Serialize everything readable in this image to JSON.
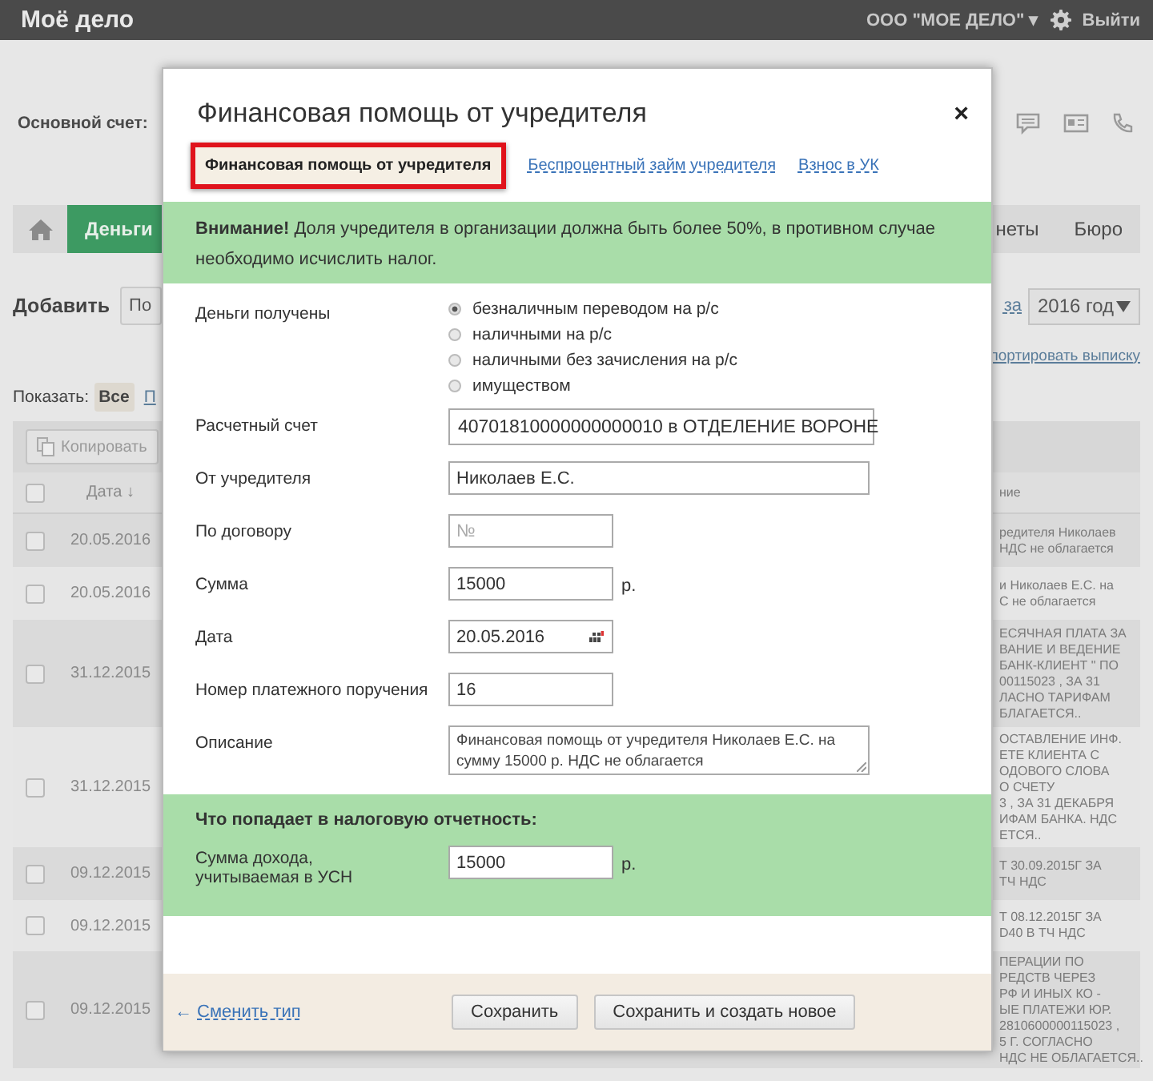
{
  "top_bar": {
    "logo": "Моё дело",
    "company": "ООО \"МОЕ ДЕЛО\"",
    "company_caret": "▾",
    "logout": "Выйти"
  },
  "account_label": "Основной счет:",
  "nav": [
    {
      "label": "Деньги",
      "selected": true
    },
    {
      "label": "неты",
      "selected": false
    },
    {
      "label": "Бюро",
      "selected": false
    }
  ],
  "toolbar": {
    "add_label": "Добавить",
    "add_button": "По",
    "period_link": "за",
    "year_select": "2016 год",
    "export_link": "портировать выписку"
  },
  "filter": {
    "label": "Показать:",
    "options": [
      {
        "label": "Все",
        "selected": true
      },
      {
        "label": "П",
        "selected": false
      }
    ]
  },
  "copy_button": "Копировать",
  "table": {
    "header_checked": false,
    "columns": [
      "Дата ↓",
      "ние"
    ],
    "rows": [
      {
        "checked": false,
        "date": "20.05.2016",
        "description": "редителя Николаев\nНДС не облагается"
      },
      {
        "checked": false,
        "date": "20.05.2016",
        "description": "и Николаев Е.С. на\nС не облагается"
      },
      {
        "checked": false,
        "date": "31.12.2015",
        "description": "ЕСЯЧНАЯ ПЛАТА ЗА\nВАНИЕ И ВЕДЕНИЕ\nБАНК-КЛИЕНТ \" ПО\n00115023 , ЗА 31\nЛАСНО ТАРИФАМ\nБЛАГАЕТСЯ.."
      },
      {
        "checked": false,
        "date": "31.12.2015",
        "description": "ОСТАВЛЕНИЕ ИНФ.\nЕТЕ КЛИЕНТА С\nОДОВОГО СЛОВА\nО СЧЕТУ\n3 , ЗА 31 ДЕКАБРЯ\nИФАМ БАНКА. НДС\nЕТСЯ.."
      },
      {
        "checked": false,
        "date": "09.12.2015",
        "description": "Т 30.09.2015Г ЗА\nТЧ НДС"
      },
      {
        "checked": false,
        "date": "09.12.2015",
        "description": "Т 08.12.2015Г ЗА\nD40 В ТЧ НДС"
      },
      {
        "checked": false,
        "date": "09.12.2015",
        "description": "ПЕРАЦИИ ПО\nРЕДСТВ ЧЕРЕЗ\nРФ И ИНЫХ КО -\nЫЕ ПЛАТЕЖИ ЮР.\n2810600000115023 ,\n5 Г. СОГЛАСНО\nНДС НЕ ОБЛАГАЕТСЯ.."
      }
    ]
  },
  "modal": {
    "title": "Финансовая помощь от учредителя",
    "close": "×",
    "tabs": [
      {
        "label": "Финансовая помощь от учредителя",
        "selected": true
      },
      {
        "label": "Беспроцентный займ учредителя",
        "selected": false
      },
      {
        "label": "Взнос в УК",
        "selected": false
      }
    ],
    "alert": "**Внимание!** Доля учредителя в организации должна быть более 50%, в противном случае необходимо исчислить налог.",
    "fields": [
      {
        "kind": "radio",
        "label": "Деньги получены",
        "options": [
          {
            "label": "безналичным переводом на р/с",
            "selected": true
          },
          {
            "label": "наличными на р/с",
            "selected": false
          },
          {
            "label": "наличными без зачисления на р/с",
            "selected": false
          },
          {
            "label": "имуществом",
            "selected": false
          }
        ]
      },
      {
        "kind": "select",
        "label": "Расчетный счет",
        "value": "40701810000000000010 в ОТДЕЛЕНИЕ ВОРОНЕ"
      },
      {
        "kind": "text",
        "label": "От учредителя",
        "value": "Николаев Е.С."
      },
      {
        "kind": "short",
        "label": "По договору",
        "placeholder": "№"
      },
      {
        "kind": "amount",
        "label": "Сумма",
        "value": "15000",
        "unit": "р."
      },
      {
        "kind": "date",
        "label": "Дата",
        "value": "20.05.2016"
      },
      {
        "kind": "short",
        "label": "Номер платежного поручения",
        "value": "16"
      },
      {
        "kind": "textarea",
        "label": "Описание",
        "value": "Финансовая помощь от учредителя Николаев Е.С. на сумму 15000 р. НДС не облагается"
      }
    ],
    "tax_section": {
      "title": "Что попадает в налоговую отчетность:",
      "fields": [
        {
          "label": "Сумма дохода,\nучитываемая в УСН",
          "value": "15000",
          "unit": "р."
        }
      ]
    },
    "footer": {
      "back_arrow": "←",
      "back_link": "Сменить тип",
      "buttons": [
        "Сохранить",
        "Сохранить и создать новое"
      ]
    }
  }
}
